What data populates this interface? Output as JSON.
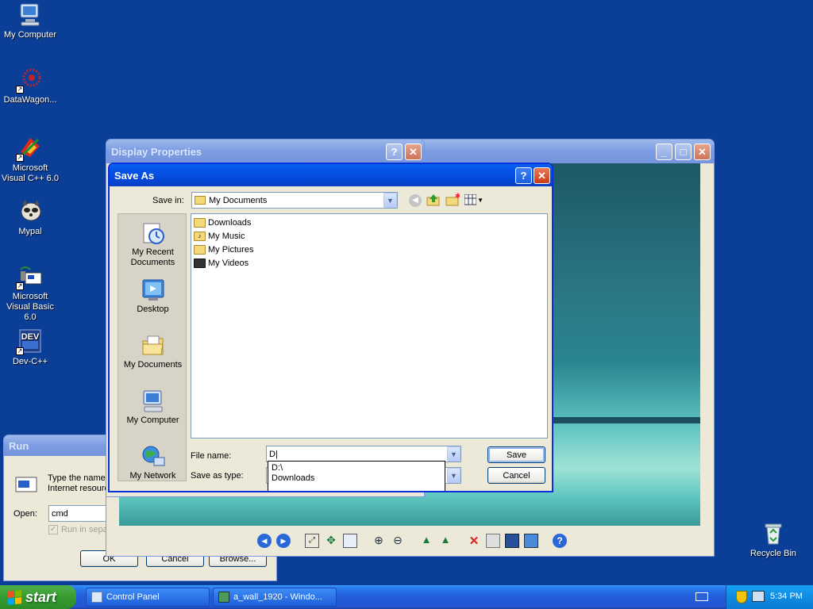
{
  "desktop": {
    "icons": [
      {
        "label": "My Computer",
        "icon": "my-computer-icon"
      },
      {
        "label": "DataWagon...",
        "icon": "datawagon-icon"
      },
      {
        "label": "Microsoft Visual C++ 6.0",
        "icon": "visual-cpp-icon"
      },
      {
        "label": "Mypal",
        "icon": "mypal-icon"
      },
      {
        "label": "Microsoft Visual Basic 6.0",
        "icon": "visual-basic-icon"
      },
      {
        "label": "Dev-C++",
        "icon": "devcpp-icon"
      },
      {
        "label": "Recycle Bin",
        "icon": "recycle-bin-icon"
      }
    ],
    "devcpp_badge": "DEV"
  },
  "run_dialog": {
    "title": "Run",
    "description": "Type the name of a program, folder, document, or Internet resource",
    "open_label": "Open:",
    "open_value": "cmd",
    "separate_label": "Run in separate memory space",
    "ok": "OK",
    "cancel": "Cancel",
    "browse": "Browse..."
  },
  "display_properties": {
    "title": "Display Properties"
  },
  "photo_viewer": {
    "toolbar_icons": [
      "previous-icon",
      "next-icon",
      "best-fit-icon",
      "actual-size-icon",
      "slideshow-icon",
      "zoom-in-icon",
      "zoom-out-icon",
      "rotate-cw-icon",
      "rotate-ccw-icon",
      "delete-icon",
      "print-icon",
      "save-icon",
      "edit-icon",
      "help-icon"
    ]
  },
  "save_as": {
    "title": "Save As",
    "save_in_label": "Save in:",
    "save_in_value": "My Documents",
    "places": [
      {
        "label": "My Recent Documents",
        "icon": "recent-documents-icon"
      },
      {
        "label": "Desktop",
        "icon": "desktop-icon"
      },
      {
        "label": "My Documents",
        "icon": "my-documents-icon"
      },
      {
        "label": "My Computer",
        "icon": "my-computer-icon"
      },
      {
        "label": "My Network",
        "icon": "my-network-icon"
      }
    ],
    "files": [
      "Downloads",
      "My Music",
      "My Pictures",
      "My Videos"
    ],
    "file_name_label": "File name:",
    "file_name_value": "D|",
    "save_as_type_label": "Save as type:",
    "autocomplete": [
      "D:\\",
      "Downloads"
    ],
    "save_button": "Save",
    "cancel_button": "Cancel"
  },
  "taskbar": {
    "start": "start",
    "tasks": [
      {
        "label": "Control Panel",
        "icon": "control-panel-icon"
      },
      {
        "label": "a_wall_1920 - Windo...",
        "icon": "image-viewer-icon"
      }
    ],
    "clock": "5:34 PM"
  },
  "colors": {
    "desktop": "#0b3f97",
    "title_active": "#0758ee",
    "dialog_face": "#ece9d8"
  }
}
